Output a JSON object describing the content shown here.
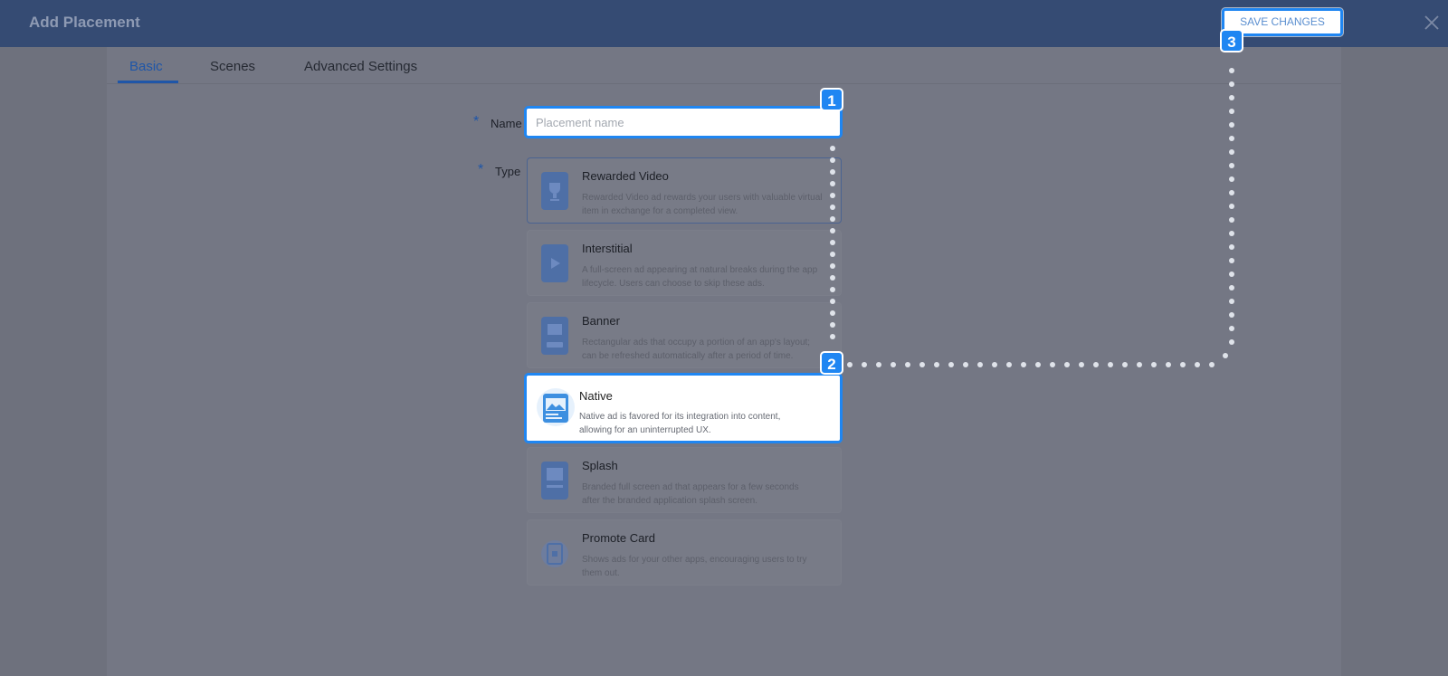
{
  "header": {
    "title": "Add Placement",
    "save_label": "SAVE CHANGES",
    "close_icon": "close-icon"
  },
  "tabs": [
    {
      "label": "Basic",
      "active": true
    },
    {
      "label": "Scenes",
      "active": false
    },
    {
      "label": "Advanced Settings",
      "active": false
    }
  ],
  "form": {
    "required_marker": "*",
    "name_label": "Name",
    "name_placeholder": "Placement name",
    "name_value": "",
    "type_label": "Type",
    "types": [
      {
        "title": "Rewarded Video",
        "desc": "Rewarded Video ad rewards your users with valuable virtual\nitem in exchange for a completed view.",
        "icon": "trophy-icon"
      },
      {
        "title": "Interstitial",
        "desc": "A full-screen ad appearing at natural breaks during the app\nlifecycle. Users can choose to skip these ads.",
        "icon": "play-icon"
      },
      {
        "title": "Banner",
        "desc": "Rectangular ads that occupy a portion of an app's layout;\ncan be refreshed automatically after a period of time.",
        "icon": "banner-icon"
      },
      {
        "title": "Native",
        "desc": "Native ad is favored for its integration into content,\nallowing for an uninterrupted UX.",
        "icon": "native-image-icon",
        "selected": true
      },
      {
        "title": "Splash",
        "desc": "Branded full screen ad that appears for a few seconds\nafter the branded application splash screen.",
        "icon": "splash-icon"
      },
      {
        "title": "Promote Card",
        "desc": "Shows ads for your other apps, encouraging users to try\nthem out.",
        "icon": "promote-card-icon"
      }
    ]
  },
  "annotations": [
    {
      "number": "1"
    },
    {
      "number": "2"
    },
    {
      "number": "3"
    }
  ],
  "colors": {
    "accent": "#1f86f2",
    "header_bg": "#354b73",
    "overlay_bg": "#6e717d",
    "tab_active": "#1f56a8"
  }
}
